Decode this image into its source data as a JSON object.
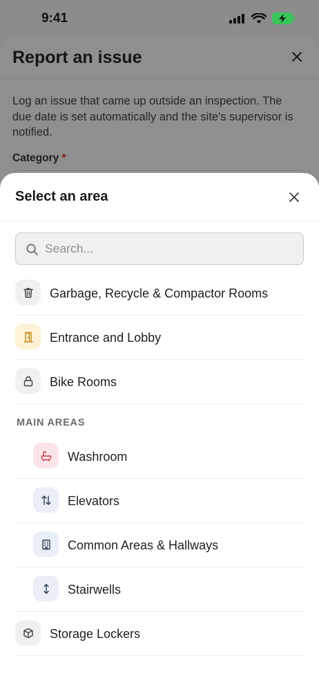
{
  "status_bar": {
    "time": "9:41"
  },
  "background_form": {
    "title": "Report an issue",
    "description": "Log an issue that came up outside an inspection. The due date is set automatically and the site's supervisor is notified.",
    "category_label": "Category",
    "required_marker": "*"
  },
  "sheet": {
    "title": "Select an area",
    "search": {
      "placeholder": "Search...",
      "value": ""
    },
    "top_items": [
      {
        "label": "Garbage, Recycle & Compactor Rooms",
        "icon": "trash-icon"
      },
      {
        "label": "Entrance and Lobby",
        "icon": "door-icon"
      },
      {
        "label": "Bike Rooms",
        "icon": "lock-icon"
      }
    ],
    "section_label": "MAIN AREAS",
    "main_items": [
      {
        "label": "Washroom",
        "icon": "bathtub-icon"
      },
      {
        "label": "Elevators",
        "icon": "up-down-arrows-icon"
      },
      {
        "label": "Common Areas & Hallways",
        "icon": "building-icon"
      },
      {
        "label": "Stairwells",
        "icon": "vertical-arrow-icon"
      }
    ],
    "bottom_items": [
      {
        "label": "Storage Lockers",
        "icon": "box-icon"
      }
    ]
  },
  "colors": {
    "overlay": "#8f8f8f",
    "sheet_bg": "#ffffff",
    "required": "#8a1a1a",
    "washroom_icon": "#c7394a",
    "entrance_icon": "#c48a1f",
    "blue_icon": "#2d3a55",
    "battery": "#3ac45a"
  }
}
